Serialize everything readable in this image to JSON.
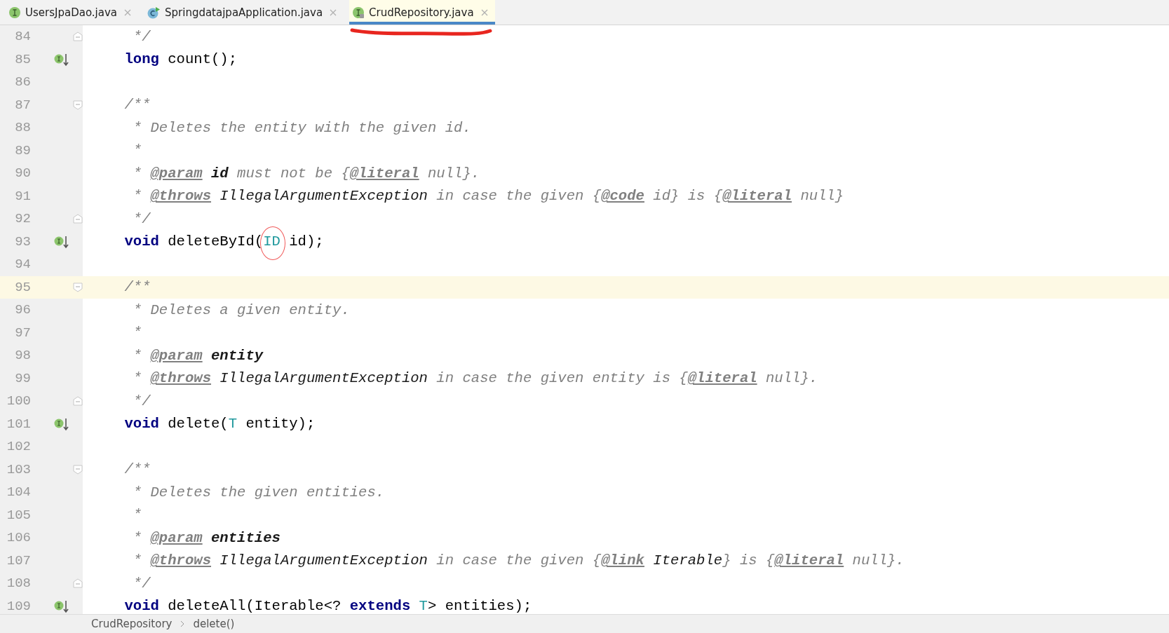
{
  "tabs": [
    {
      "label": "UsersJpaDao.java",
      "kind": "interface",
      "selected": false,
      "annotated": false
    },
    {
      "label": "SpringdatajpaApplication.java",
      "kind": "class",
      "selected": false,
      "annotated": false
    },
    {
      "label": "CrudRepository.java",
      "kind": "interface",
      "selected": true,
      "annotated": true
    }
  ],
  "editor": {
    "lines": [
      {
        "number": "84",
        "fold_close": true,
        "tokens": [
          {
            "kind": "comment",
            "text": " */"
          }
        ]
      },
      {
        "number": "85",
        "marker": true,
        "tokens": [
          {
            "kind": "keyword",
            "text": "long"
          },
          {
            "kind": "plain",
            "text": " count();"
          }
        ]
      },
      {
        "number": "86"
      },
      {
        "number": "87",
        "fold_open": true,
        "tokens": [
          {
            "kind": "comment",
            "text": "/**"
          }
        ]
      },
      {
        "number": "88",
        "tokens": [
          {
            "kind": "comment",
            "text": " * Deletes the entity with the given id."
          }
        ]
      },
      {
        "number": "89",
        "tokens": [
          {
            "kind": "comment",
            "text": " *"
          }
        ]
      },
      {
        "number": "90",
        "tokens": [
          {
            "kind": "comment",
            "text": " * "
          },
          {
            "kind": "doctag",
            "text": "@param"
          },
          {
            "kind": "docparam",
            "text": " id"
          },
          {
            "kind": "comment",
            "text": " must not be {"
          },
          {
            "kind": "doctag",
            "text": "@literal"
          },
          {
            "kind": "comment",
            "text": " null}."
          }
        ]
      },
      {
        "number": "91",
        "tokens": [
          {
            "kind": "comment",
            "text": " * "
          },
          {
            "kind": "doctag",
            "text": "@throws"
          },
          {
            "kind": "docref",
            "text": " IllegalArgumentException"
          },
          {
            "kind": "comment",
            "text": " in case the given {"
          },
          {
            "kind": "doctag",
            "text": "@code"
          },
          {
            "kind": "comment",
            "text": " id} is {"
          },
          {
            "kind": "doctag",
            "text": "@literal"
          },
          {
            "kind": "comment",
            "text": " null}"
          }
        ]
      },
      {
        "number": "92",
        "fold_close": true,
        "tokens": [
          {
            "kind": "comment",
            "text": " */"
          }
        ]
      },
      {
        "number": "93",
        "marker": true,
        "tokens": [
          {
            "kind": "keyword",
            "text": "void"
          },
          {
            "kind": "plain",
            "text": " deleteById("
          },
          {
            "kind": "type",
            "text": "ID",
            "circled": true
          },
          {
            "kind": "plain",
            "text": " id);"
          }
        ]
      },
      {
        "number": "94"
      },
      {
        "number": "95",
        "fold_open": true,
        "current": true,
        "tokens": [
          {
            "kind": "comment",
            "text": "/**"
          }
        ]
      },
      {
        "number": "96",
        "tokens": [
          {
            "kind": "comment",
            "text": " * Deletes a given entity."
          }
        ]
      },
      {
        "number": "97",
        "tokens": [
          {
            "kind": "comment",
            "text": " *"
          }
        ]
      },
      {
        "number": "98",
        "tokens": [
          {
            "kind": "comment",
            "text": " * "
          },
          {
            "kind": "doctag",
            "text": "@param"
          },
          {
            "kind": "docparam",
            "text": " entity"
          }
        ]
      },
      {
        "number": "99",
        "tokens": [
          {
            "kind": "comment",
            "text": " * "
          },
          {
            "kind": "doctag",
            "text": "@throws"
          },
          {
            "kind": "docref",
            "text": " IllegalArgumentException"
          },
          {
            "kind": "comment",
            "text": " in case the given entity is {"
          },
          {
            "kind": "doctag",
            "text": "@literal"
          },
          {
            "kind": "comment",
            "text": " null}."
          }
        ]
      },
      {
        "number": "100",
        "fold_close": true,
        "tokens": [
          {
            "kind": "comment",
            "text": " */"
          }
        ]
      },
      {
        "number": "101",
        "marker": true,
        "tokens": [
          {
            "kind": "keyword",
            "text": "void"
          },
          {
            "kind": "plain",
            "text": " delete("
          },
          {
            "kind": "type",
            "text": "T"
          },
          {
            "kind": "plain",
            "text": " entity);"
          }
        ]
      },
      {
        "number": "102"
      },
      {
        "number": "103",
        "fold_open": true,
        "tokens": [
          {
            "kind": "comment",
            "text": "/**"
          }
        ]
      },
      {
        "number": "104",
        "tokens": [
          {
            "kind": "comment",
            "text": " * Deletes the given entities."
          }
        ]
      },
      {
        "number": "105",
        "tokens": [
          {
            "kind": "comment",
            "text": " *"
          }
        ]
      },
      {
        "number": "106",
        "tokens": [
          {
            "kind": "comment",
            "text": " * "
          },
          {
            "kind": "doctag",
            "text": "@param"
          },
          {
            "kind": "docparam",
            "text": " entities"
          }
        ]
      },
      {
        "number": "107",
        "tokens": [
          {
            "kind": "comment",
            "text": " * "
          },
          {
            "kind": "doctag",
            "text": "@throws"
          },
          {
            "kind": "docref",
            "text": " IllegalArgumentException"
          },
          {
            "kind": "comment",
            "text": " in case the given {"
          },
          {
            "kind": "doctag",
            "text": "@link"
          },
          {
            "kind": "docref",
            "text": " Iterable"
          },
          {
            "kind": "comment",
            "text": "} is {"
          },
          {
            "kind": "doctag",
            "text": "@literal"
          },
          {
            "kind": "comment",
            "text": " null}."
          }
        ]
      },
      {
        "number": "108",
        "fold_close": true,
        "tokens": [
          {
            "kind": "comment",
            "text": " */"
          }
        ]
      },
      {
        "number": "109",
        "marker": true,
        "tokens": [
          {
            "kind": "keyword",
            "text": "void"
          },
          {
            "kind": "plain",
            "text": " deleteAll(Iterable<? "
          },
          {
            "kind": "keyword",
            "text": "extends"
          },
          {
            "kind": "type",
            "text": " T"
          },
          {
            "kind": "plain",
            "text": "> entities);"
          }
        ]
      }
    ]
  },
  "breadcrumbs": [
    "CrudRepository",
    "delete()"
  ]
}
